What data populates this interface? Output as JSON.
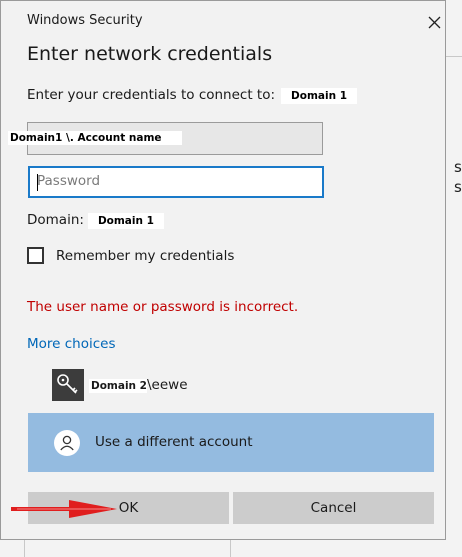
{
  "dialog": {
    "window_title": "Windows Security",
    "heading": "Enter network credentials",
    "prompt_text": "Enter your credentials to connect to:",
    "prompt_target": "Domain 1",
    "username_value": "Domain1 \\. Account name",
    "password_placeholder": "Password",
    "domain_label": "Domain:",
    "domain_value": "Domain 1",
    "remember_label": "Remember my credentials",
    "remember_checked": false,
    "error_text": "The user name or password is incorrect.",
    "more_choices": "More choices",
    "account_domain": "Domain 2",
    "account_user": "\\eewe",
    "different_account": "Use a different account",
    "ok_label": "OK",
    "cancel_label": "Cancel"
  },
  "icons": {
    "close": "close-icon",
    "key": "key-icon",
    "person": "person-icon",
    "arrow": "red-arrow-annotation"
  },
  "colors": {
    "accent": "#1a7ac9",
    "link": "#0067b8",
    "error": "#c00000",
    "selected_tile": "#94bbe0",
    "annotation": "#e01e1e"
  }
}
